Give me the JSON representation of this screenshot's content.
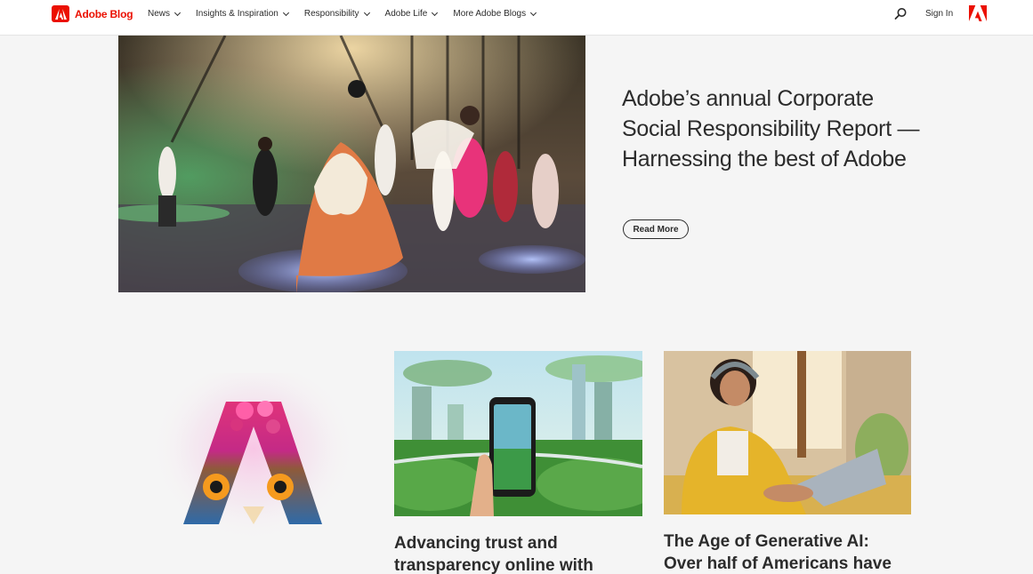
{
  "header": {
    "brand": "Adobe Blog",
    "nav": [
      {
        "label": "News"
      },
      {
        "label": "Insights & Inspiration"
      },
      {
        "label": "Responsibility"
      },
      {
        "label": "Adobe Life"
      },
      {
        "label": "More Adobe Blogs"
      }
    ],
    "search_icon": "search-icon",
    "signin_label": "Sign In",
    "corner_logo": "adobe-logo-icon"
  },
  "hero": {
    "title": "Adobe’s annual Corporate Social Responsibility Report — Harnessing the best of Adobe",
    "cta_label": "Read More"
  },
  "cards": [
    {
      "title": "Advancing trust and transparency online with"
    },
    {
      "title": "The Age of Generative AI: Over half of Americans have used"
    }
  ],
  "colors": {
    "brand_red": "#eb1000",
    "text": "#2c2c2c",
    "page_bg": "#f5f5f5"
  }
}
